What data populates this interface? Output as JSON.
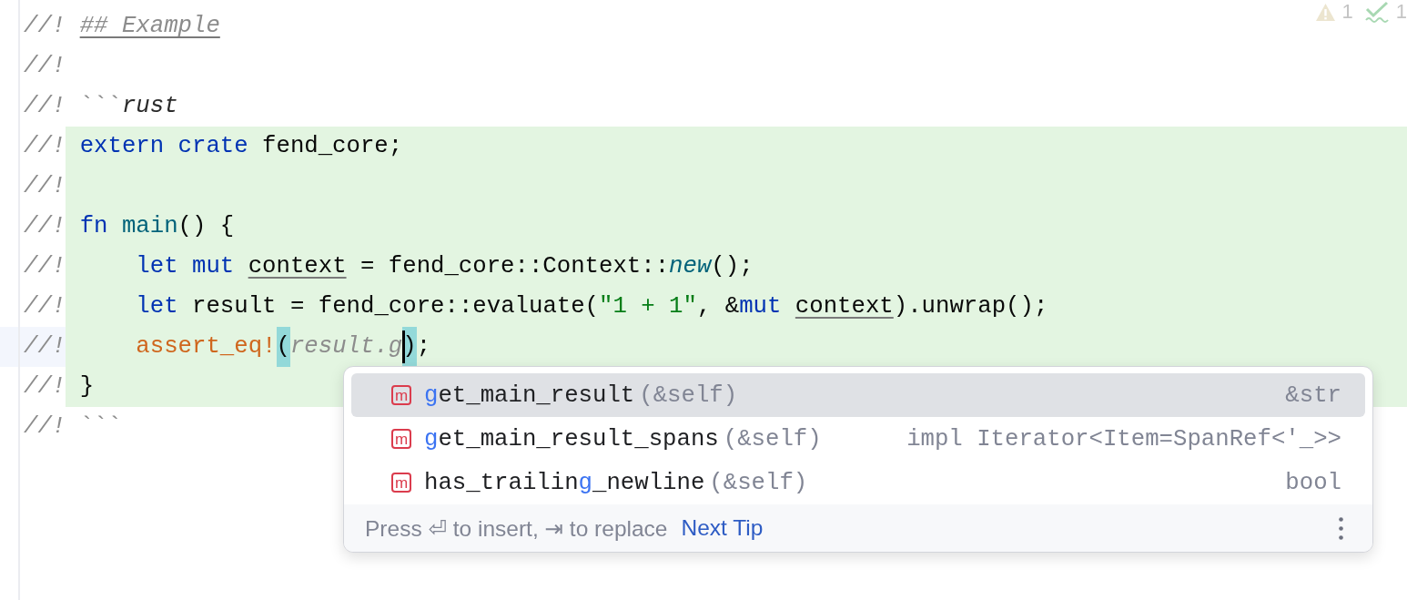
{
  "editor": {
    "lines": [
      {
        "prefix": "//!",
        "current": false,
        "injected": false,
        "words": [
          [
            {
              "kind": "doc_heading",
              "text": "## Example"
            }
          ]
        ]
      },
      {
        "prefix": "//!",
        "current": false,
        "injected": false
      },
      {
        "prefix": "//!",
        "current": false,
        "injected": false,
        "words": [
          [
            {
              "kind": "fence",
              "text": "```"
            },
            {
              "kind": "lang",
              "text": "rust"
            }
          ]
        ]
      },
      {
        "prefix": "//!",
        "current": false,
        "injected": true,
        "words": [
          [
            {
              "kind": "keyword",
              "text": "extern"
            }
          ],
          [
            {
              "kind": "keyword",
              "text": "crate"
            }
          ],
          [
            {
              "kind": "plain",
              "text": "fend_core;"
            }
          ]
        ]
      },
      {
        "prefix": "//!",
        "current": false,
        "injected": true
      },
      {
        "prefix": "//!",
        "current": false,
        "injected": true,
        "words": [
          [
            {
              "kind": "keyword",
              "text": "fn"
            }
          ],
          [
            {
              "kind": "function",
              "text": "main"
            },
            {
              "kind": "plain",
              "text": "()"
            }
          ],
          [
            {
              "kind": "plain",
              "text": "{"
            }
          ]
        ],
        "children": [
          {
            "prefix": "//!",
            "current": false,
            "injected": true,
            "words": [
              [
                {
                  "kind": "keyword",
                  "text": "let"
                }
              ],
              [
                {
                  "kind": "keyword",
                  "text": "mut"
                }
              ],
              [
                {
                  "kind": "variable",
                  "text": "context"
                }
              ],
              [
                {
                  "kind": "plain",
                  "text": "= fend_core::Context::"
                },
                {
                  "kind": "call",
                  "text": "new"
                },
                {
                  "kind": "plain",
                  "text": "();"
                }
              ]
            ]
          },
          {
            "prefix": "//!",
            "current": false,
            "injected": true,
            "words": [
              [
                {
                  "kind": "keyword",
                  "text": "let"
                }
              ],
              [
                {
                  "kind": "plain",
                  "text": "result = fend_core::evaluate("
                },
                {
                  "kind": "string",
                  "text": "\"1 + 1\""
                },
                {
                  "kind": "plain",
                  "text": ", &"
                },
                {
                  "kind": "keyword",
                  "text": "mut"
                }
              ],
              [
                {
                  "kind": "variable",
                  "text": "context"
                },
                {
                  "kind": "plain",
                  "text": ").unwrap();"
                }
              ]
            ]
          },
          {
            "prefix": "//!",
            "current": true,
            "injected": true,
            "words": [
              [
                {
                  "kind": "macro",
                  "text": "assert_eq!"
                },
                {
                  "kind": "brace",
                  "text": "("
                },
                {
                  "kind": "typed",
                  "text": "result.g"
                },
                {
                  "kind": "caret"
                },
                {
                  "kind": "brace",
                  "text": ")"
                },
                {
                  "kind": "plain",
                  "text": ";"
                }
              ]
            ]
          }
        ]
      },
      {
        "prefix": "//!",
        "current": false,
        "injected": true,
        "words": [
          [
            {
              "kind": "plain",
              "text": "}"
            }
          ]
        ]
      },
      {
        "prefix": "//!",
        "current": false,
        "injected": false,
        "words": [
          [
            {
              "kind": "fence",
              "text": "```"
            }
          ]
        ]
      }
    ]
  },
  "inspections": [
    {
      "kind": "warning",
      "count": "1"
    },
    {
      "kind": "typo",
      "count": "1"
    }
  ],
  "completion_popup": {
    "items": [
      {
        "icon_letter": "m",
        "name": [
          {
            "text": "g",
            "matched": true
          },
          {
            "text": "et_main_result",
            "matched": false
          }
        ],
        "params": "(&self)",
        "type": "&str",
        "selected": true
      },
      {
        "icon_letter": "m",
        "name": [
          {
            "text": "g",
            "matched": true
          },
          {
            "text": "et_main_result_spans",
            "matched": false
          }
        ],
        "params": "(&self)",
        "type": "impl Iterator<Item=SpanRef<'_>>",
        "selected": false
      },
      {
        "icon_letter": "m",
        "name": [
          {
            "text": "has_trailin",
            "matched": false
          },
          {
            "text": "g",
            "matched": true
          },
          {
            "text": "_newline",
            "matched": false
          }
        ],
        "params": "(&self)",
        "type": "bool",
        "selected": false
      }
    ],
    "footer": {
      "hint": "Press ⏎ to insert, ⇥ to replace",
      "link": "Next Tip"
    }
  }
}
